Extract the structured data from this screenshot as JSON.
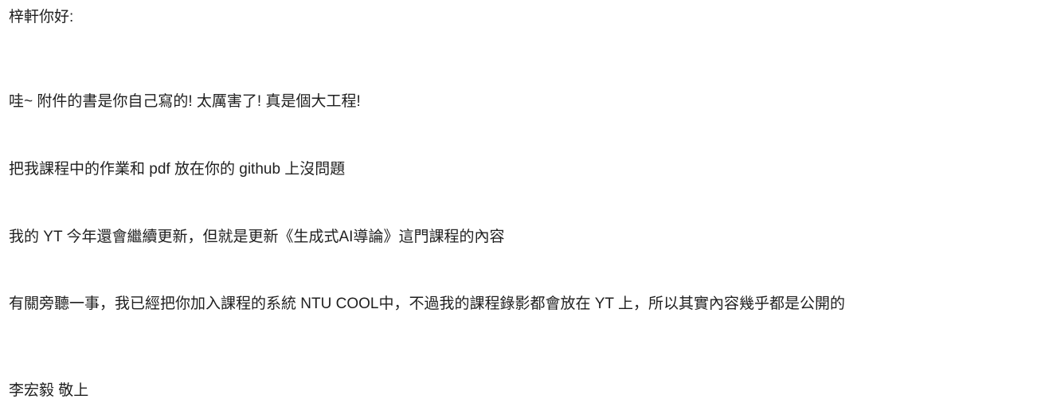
{
  "email": {
    "greeting": "梓軒你好:",
    "paragraphs": {
      "wow": "哇~ 附件的書是你自己寫的! 太厲害了! 真是個大工程!",
      "github": "把我課程中的作業和 pdf 放在你的 github 上沒問題",
      "yt": "我的 YT 今年還會繼續更新，但就是更新《生成式AI導論》這門課程的內容",
      "audit": "有關旁聽一事，我已經把你加入課程的系統 NTU COOL中，不過我的課程錄影都會放在 YT 上，所以其實內容幾乎都是公開的"
    },
    "signature": "李宏毅 敬上"
  }
}
